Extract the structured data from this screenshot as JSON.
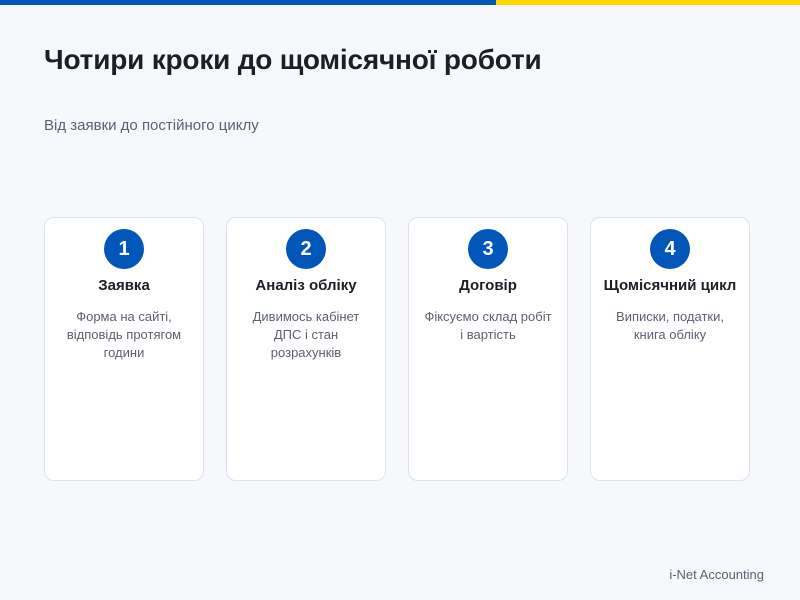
{
  "colors": {
    "accent_blue": "#0057b8",
    "accent_yellow": "#ffd700"
  },
  "header": {
    "title": "Чотири кроки до щомісячної роботи",
    "subtitle": "Від заявки до постійного циклу"
  },
  "steps": [
    {
      "number": "1",
      "title": "Заявка",
      "description": "Форма на сайті, відповідь протягом години"
    },
    {
      "number": "2",
      "title": "Аналіз обліку",
      "description": "Дивимось кабінет ДПС і стан розрахунків"
    },
    {
      "number": "3",
      "title": "Договір",
      "description": "Фіксуємо склад робіт і вартість"
    },
    {
      "number": "4",
      "title": "Щомісячний цикл",
      "description": "Виписки, податки, книга обліку"
    }
  ],
  "footer": {
    "brand": "i-Net Accounting"
  }
}
